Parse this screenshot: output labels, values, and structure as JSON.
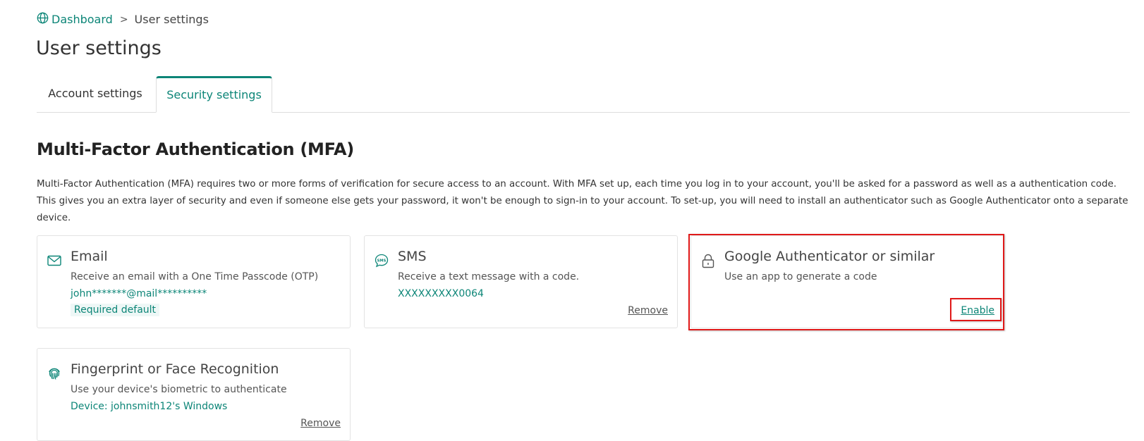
{
  "breadcrumb": {
    "home_icon": "globe-icon",
    "home_label": "Dashboard",
    "separator": ">",
    "current": "User settings"
  },
  "page": {
    "title": "User settings"
  },
  "tabs": [
    {
      "label": "Account settings",
      "active": false
    },
    {
      "label": "Security settings",
      "active": true
    }
  ],
  "mfa": {
    "title": "Multi-Factor Authentication (MFA)",
    "description": "Multi-Factor Authentication (MFA) requires two or more forms of verification for secure access to an account. With MFA set up, each time you log in to your account, you'll be asked for a password as well as a authentication code. This gives you an extra layer of security and even if someone else gets your password, it won't be enough to sign-in to your account. To set-up, you will need to install an authenticator such as Google Authenticator onto a separate device.",
    "methods": {
      "email": {
        "icon": "envelope-icon",
        "title": "Email",
        "description": "Receive an email with a One Time Passcode (OTP)",
        "value": "john*******@mail**********",
        "badge": "Required default"
      },
      "sms": {
        "icon": "sms-bubble-icon",
        "title": "SMS",
        "description": "Receive a text message with a code.",
        "value": "XXXXXXXXX0064",
        "action": "Remove"
      },
      "authenticator": {
        "icon": "lock-icon",
        "title": "Google Authenticator or similar",
        "description": "Use an app to generate a code",
        "action": "Enable"
      },
      "biometric": {
        "icon": "fingerprint-icon",
        "title": "Fingerprint or Face Recognition",
        "description": "Use your device's biometric to authenticate",
        "value": "Device: johnsmith12's Windows",
        "action": "Remove"
      }
    }
  },
  "colors": {
    "accent": "#0c8577",
    "highlight": "#e01919",
    "text": "#333333",
    "border": "#e3e3e3"
  }
}
